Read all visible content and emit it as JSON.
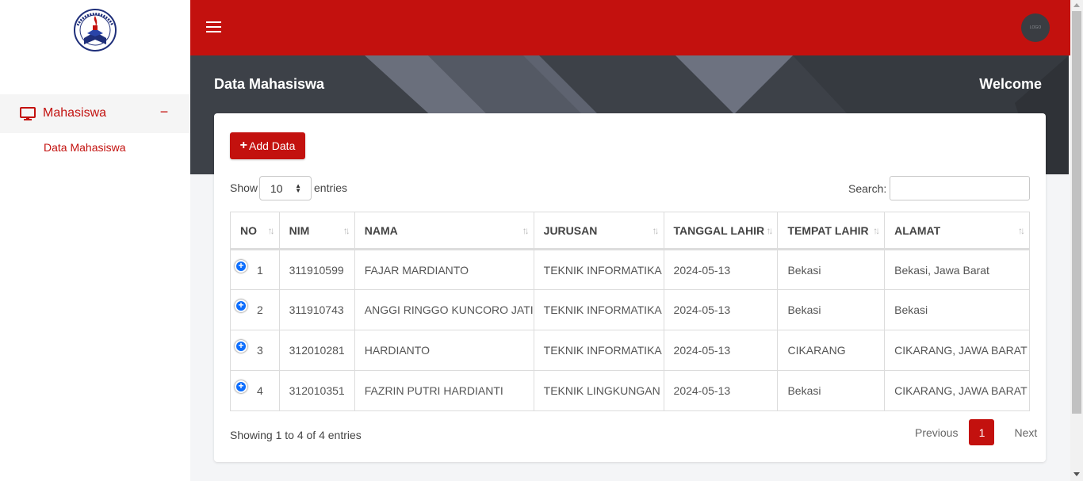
{
  "sidebar": {
    "logo_text": "UNIVERSITAS PELITA BANGSA",
    "group": {
      "label": "Mahasiswa",
      "toggle": "−"
    },
    "sub_item": {
      "label": "Data Mahasiswa"
    }
  },
  "header": {
    "page_title": "Data Mahasiswa",
    "welcome": "Welcome",
    "avatar_text": "LOGO"
  },
  "toolbar": {
    "add_label": "Add Data",
    "add_icon": "+"
  },
  "length": {
    "show": "Show",
    "value": "10",
    "entries": "entries"
  },
  "search": {
    "label": "Search:",
    "value": ""
  },
  "table": {
    "columns": [
      "NO",
      "NIM",
      "NAMA",
      "JURUSAN",
      "TANGGAL LAHIR",
      "TEMPAT LAHIR",
      "ALAMAT"
    ],
    "rows": [
      {
        "no": "1",
        "nim": "311910599",
        "nama": "FAJAR MARDIANTO",
        "jurusan": "TEKNIK INFORMATIKA",
        "tanggal": "2024-05-13",
        "tempat": "Bekasi",
        "alamat": "Bekasi, Jawa Barat"
      },
      {
        "no": "2",
        "nim": "311910743",
        "nama": "ANGGI RINGGO KUNCORO JATI",
        "jurusan": "TEKNIK INFORMATIKA",
        "tanggal": "2024-05-13",
        "tempat": "Bekasi",
        "alamat": "Bekasi"
      },
      {
        "no": "3",
        "nim": "312010281",
        "nama": "HARDIANTO",
        "jurusan": "TEKNIK INFORMATIKA",
        "tanggal": "2024-05-13",
        "tempat": "CIKARANG",
        "alamat": "CIKARANG, JAWA BARAT"
      },
      {
        "no": "4",
        "nim": "312010351",
        "nama": "FAZRIN PUTRI HARDIANTI",
        "jurusan": "TEKNIK LINGKUNGAN",
        "tanggal": "2024-05-13",
        "tempat": "Bekasi",
        "alamat": "CIKARANG, JAWA BARAT"
      }
    ]
  },
  "footer": {
    "info": "Showing 1 to 4 of 4 entries",
    "previous": "Previous",
    "page": "1",
    "next": "Next"
  },
  "colors": {
    "brand_red": "#c3110e",
    "header_dark": "#3d4148",
    "expand_blue": "#0d6efd"
  },
  "icons": {
    "menu": "hamburger-icon",
    "nav": "monitor-icon",
    "expand": "plus-circle-icon",
    "sort": "sort-arrows-icon"
  }
}
